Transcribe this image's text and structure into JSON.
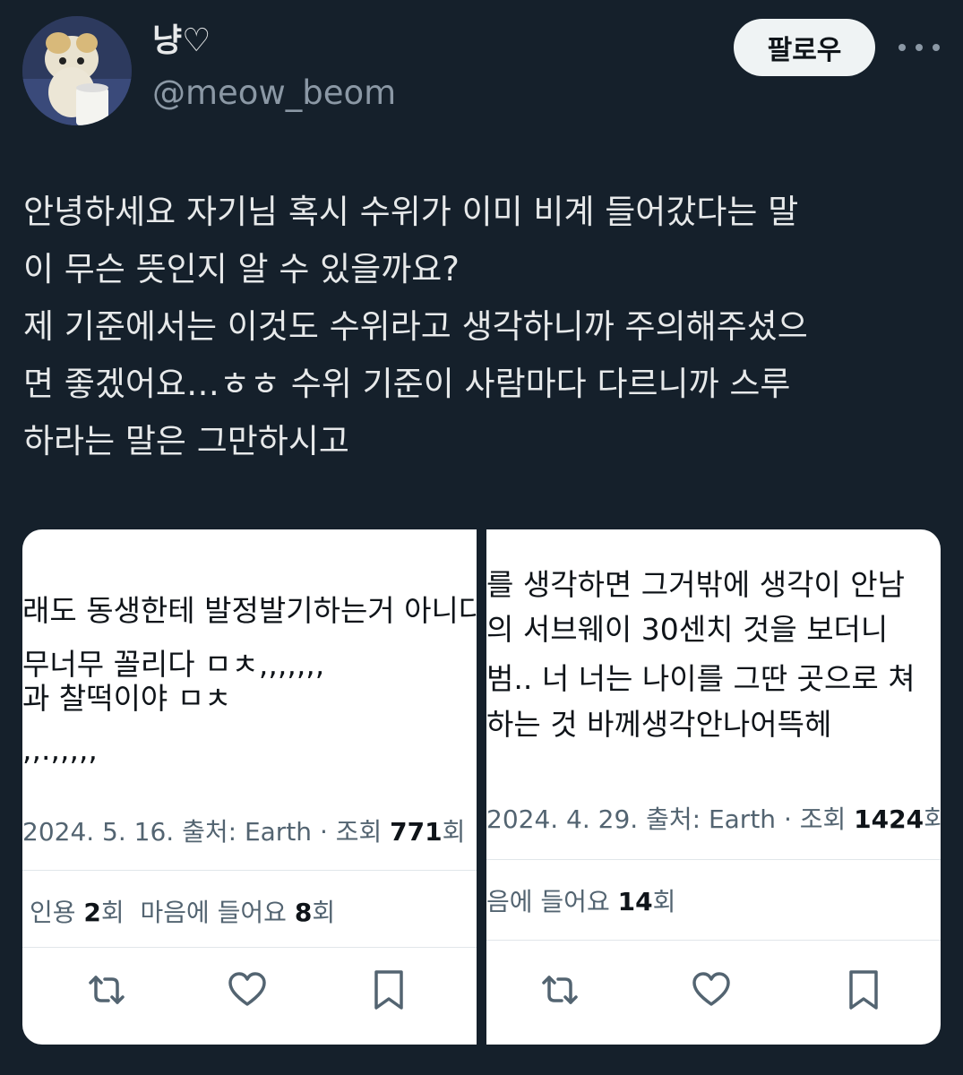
{
  "user": {
    "display_name": "냥♡",
    "handle": "@meow_beom"
  },
  "header": {
    "follow_label": "팔로우"
  },
  "tweet": {
    "lines": [
      "안녕하세요 자기님 혹시 수위가 이미 비계 들어갔다는 말",
      "이 무슨 뜻인지 알 수 있을까요?",
      "제 기준에서는 이것도 수위라고 생각하니까 주의해주셨으",
      "면 좋겠어요…ㅎㅎ 수위 기준이 사람마다 다르니까 스루",
      "하라는 말은 그만하시고"
    ]
  },
  "cards": [
    {
      "lines": [
        "래도 동생한테 발정발기하는거 아니다",
        "무너무 꼴리다 ㅁㅊ,,,,,,,",
        "과 찰떡이야 ㅁㅊ",
        ",,.,,,,,"
      ],
      "meta_prefix": "2024. 5. 16. 출처: Earth · 조회 ",
      "views": "771",
      "views_suffix": "회",
      "quote_label": "인용 ",
      "quote_count": "2",
      "quote_suffix": "회",
      "likes_label": "마음에 들어요 ",
      "likes_count": "8",
      "likes_suffix": "회"
    },
    {
      "lines": [
        "를 생각하면 그거밖에 생각이 안남",
        "의 서브웨이 30센치 것을 보더니",
        "범.. 너 너는 나이를 그딴 곳으로 쳐",
        "하는 것 바께생각안나어뜩헤"
      ],
      "meta_prefix": "2024. 4. 29. 출처: Earth · 조회 ",
      "views": "1424",
      "views_suffix": "회",
      "likes_label": "음에 들어요 ",
      "likes_count": "14",
      "likes_suffix": "회"
    }
  ],
  "icons": {
    "retweet": "retweet-icon",
    "like": "heart-icon",
    "bookmark": "bookmark-icon",
    "more": "more-icon"
  },
  "colors": {
    "background": "#15202b",
    "text": "#e7e9ea",
    "secondary": "#8b98a5",
    "button_bg": "#eff3f4"
  }
}
